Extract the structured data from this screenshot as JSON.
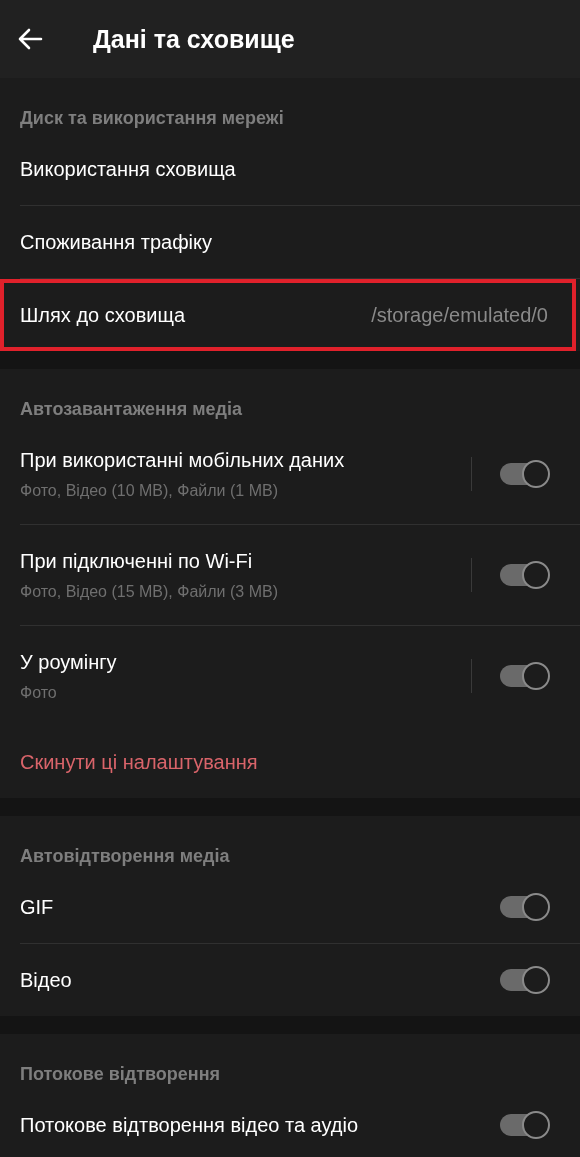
{
  "header": {
    "title": "Дані та сховище"
  },
  "sections": [
    {
      "title": "Диск та використання мережі",
      "items": [
        {
          "kind": "link",
          "label": "Використання сховища"
        },
        {
          "kind": "link",
          "label": "Споживання трафіку"
        },
        {
          "kind": "value",
          "label": "Шлях до сховища",
          "value": "/storage/emulated/0",
          "highlighted": true
        }
      ]
    },
    {
      "title": "Автозавантаження медіа",
      "items": [
        {
          "kind": "toggle",
          "label": "При використанні мобільних даних",
          "subtitle": "Фото, Відео (10 MB), Файли (1 MB)",
          "on": true
        },
        {
          "kind": "toggle",
          "label": "При підключенні по Wi-Fi",
          "subtitle": "Фото, Відео (15 MB), Файли (3 MB)",
          "on": true
        },
        {
          "kind": "toggle",
          "label": "У роумінгу",
          "subtitle": "Фото",
          "on": true
        },
        {
          "kind": "action",
          "label": "Скинути ці налаштування"
        }
      ]
    },
    {
      "title": "Автовідтворення медіа",
      "items": [
        {
          "kind": "toggle",
          "label": "GIF",
          "on": true
        },
        {
          "kind": "toggle",
          "label": "Відео",
          "on": true
        }
      ]
    },
    {
      "title": "Потокове відтворення",
      "items": [
        {
          "kind": "toggle",
          "label": "Потокове відтворення відео та аудіо",
          "on": true
        }
      ]
    }
  ]
}
